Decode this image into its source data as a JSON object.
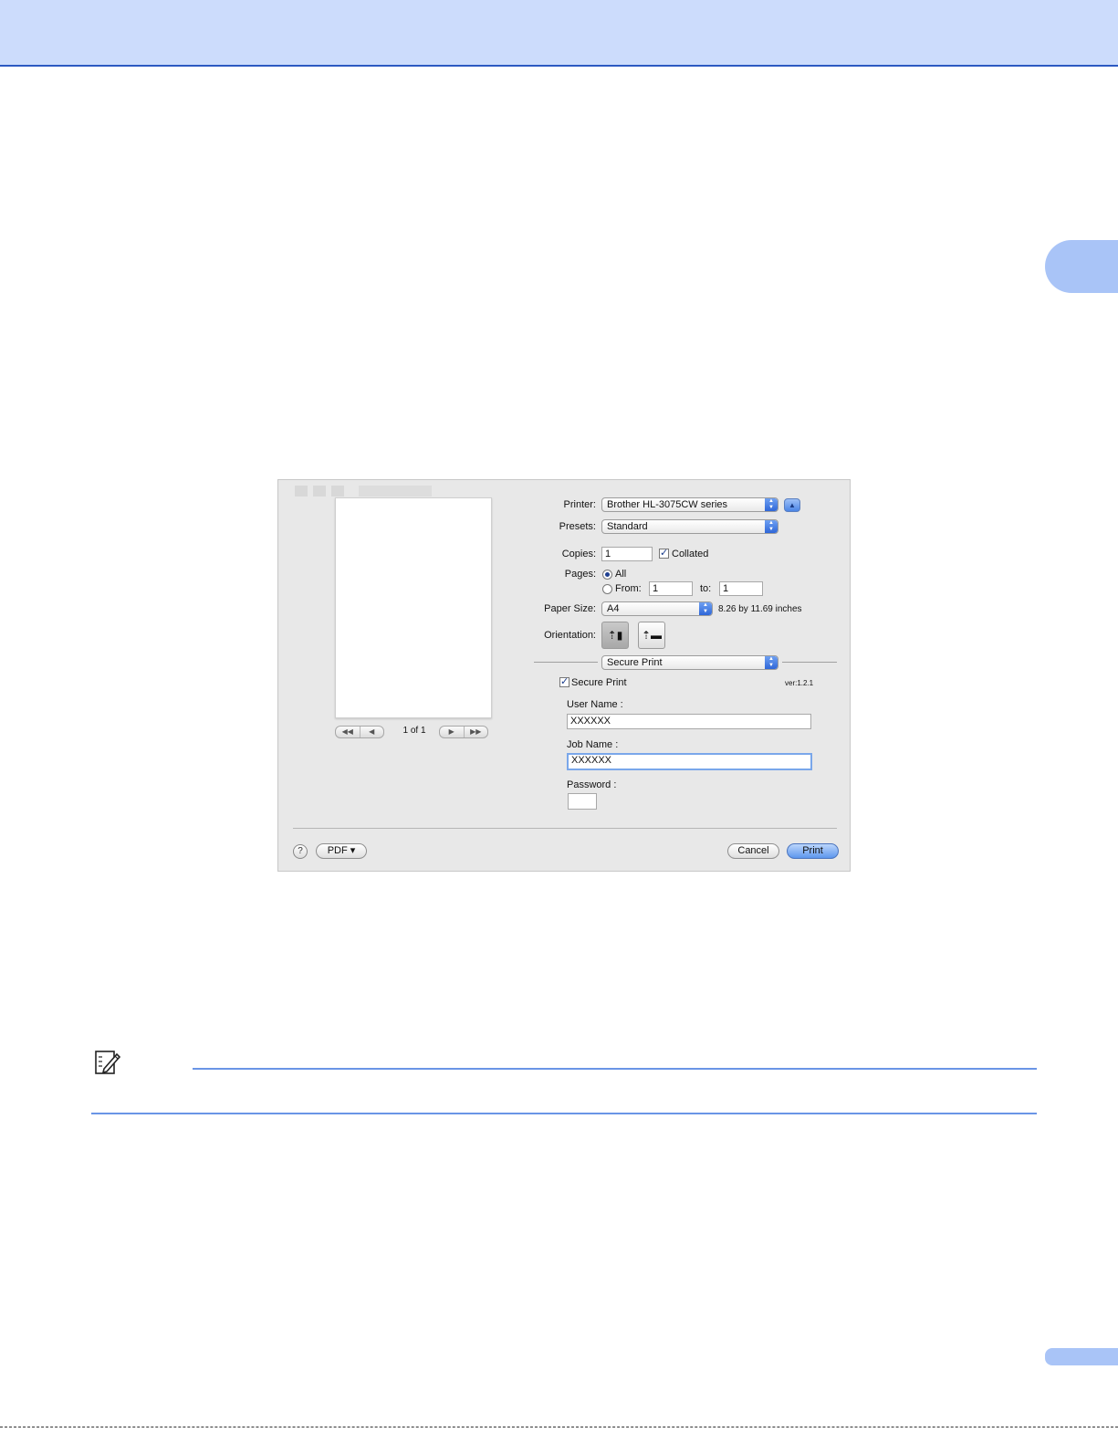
{
  "dialog": {
    "printer": {
      "label": "Printer:",
      "value": "Brother HL-3075CW series",
      "expand_icon": "triangle-up-icon"
    },
    "presets": {
      "label": "Presets:",
      "value": "Standard"
    },
    "copies": {
      "label": "Copies:",
      "value": "1",
      "collated_label": "Collated",
      "collated_checked": true
    },
    "pages": {
      "label": "Pages:",
      "all_label": "All",
      "from_label": "From:",
      "from_value": "1",
      "to_label": "to:",
      "to_value": "1",
      "selected": "All"
    },
    "paper_size": {
      "label": "Paper Size:",
      "value": "A4",
      "dimensions": "8.26 by 11.69 inches"
    },
    "orientation": {
      "label": "Orientation:",
      "selected": "portrait"
    },
    "panel": {
      "value": "Secure Print"
    },
    "secure_print": {
      "checkbox_label": "Secure Print",
      "checked": true,
      "version": "ver:1.2.1",
      "user_name_label": "User Name :",
      "user_name_value": "XXXXXX",
      "job_name_label": "Job Name :",
      "job_name_value": "XXXXXX",
      "password_label": "Password :",
      "password_value": ""
    },
    "preview": {
      "page_indicator": "1 of 1"
    },
    "footer": {
      "help_label": "?",
      "pdf_label": "PDF ▾",
      "cancel_label": "Cancel",
      "print_label": "Print"
    }
  },
  "colors": {
    "header_band": "#ccdcfc",
    "header_line": "#2c59c2",
    "tab": "#a9c4f7",
    "note_rule": "#6a95e6"
  }
}
